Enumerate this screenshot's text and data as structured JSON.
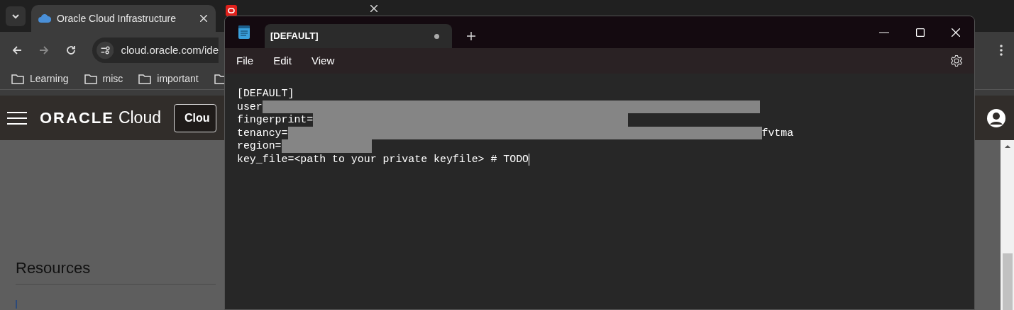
{
  "browser": {
    "tabs": [
      {
        "title": "Oracle Cloud Infrastructure",
        "selected": true
      },
      {
        "selected": false
      }
    ],
    "address": "cloud.oracle.com/ide",
    "bookmarks": [
      "Learning",
      "misc",
      "important"
    ],
    "page": {
      "brand": "ORACLE",
      "product": "Cloud",
      "header_button": "Clou",
      "section": "Resources"
    }
  },
  "notepad": {
    "tab": {
      "title": "[DEFAULT]",
      "unsaved": true
    },
    "menu": [
      "File",
      "Edit",
      "View"
    ],
    "lines": [
      {
        "text": "[DEFAULT]"
      },
      {
        "text": "user",
        "redacted": true
      },
      {
        "text": "fingerprint=",
        "redacted": true
      },
      {
        "text": "tenancy=",
        "redacted": true,
        "suffix": "fvtma"
      },
      {
        "text": "region=",
        "redacted": true
      },
      {
        "text": "key_file=<path to your private keyfile> # TODO",
        "cursor": true
      }
    ]
  }
}
